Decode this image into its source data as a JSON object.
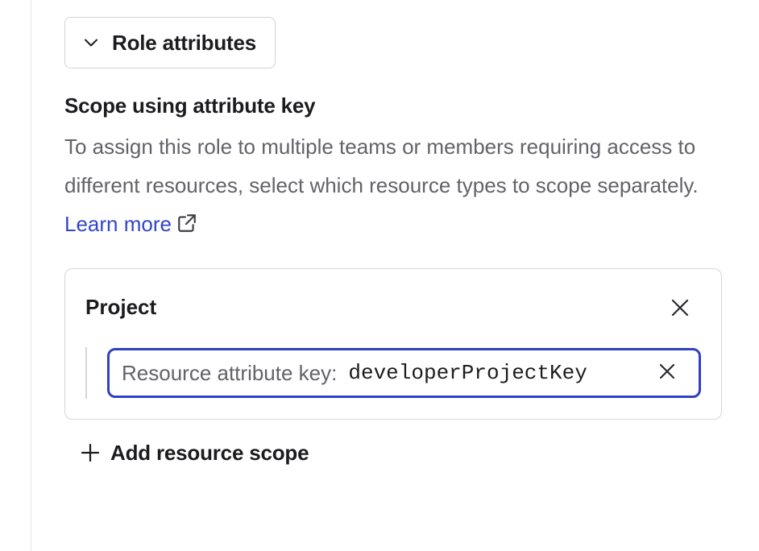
{
  "toggle": {
    "label": "Role attributes",
    "icon": "chevron-down-icon"
  },
  "section": {
    "heading": "Scope using attribute key",
    "description": "To assign this role to multiple teams or members requiring access to different resources, select which resource types to scope separately.",
    "link_text": "Learn more",
    "link_icon": "external-link-icon"
  },
  "scope_card": {
    "title": "Project",
    "close_icon": "close-icon",
    "field": {
      "prefix": "Resource attribute key:",
      "value": "developerProjectKey",
      "clear_icon": "close-icon"
    }
  },
  "add_scope": {
    "label": "Add resource scope",
    "icon": "plus-icon"
  },
  "colors": {
    "accent": "#3040c4",
    "link": "#3346c8",
    "text": "#1c1c1f",
    "muted": "#626269",
    "border": "#d6d6dc"
  }
}
